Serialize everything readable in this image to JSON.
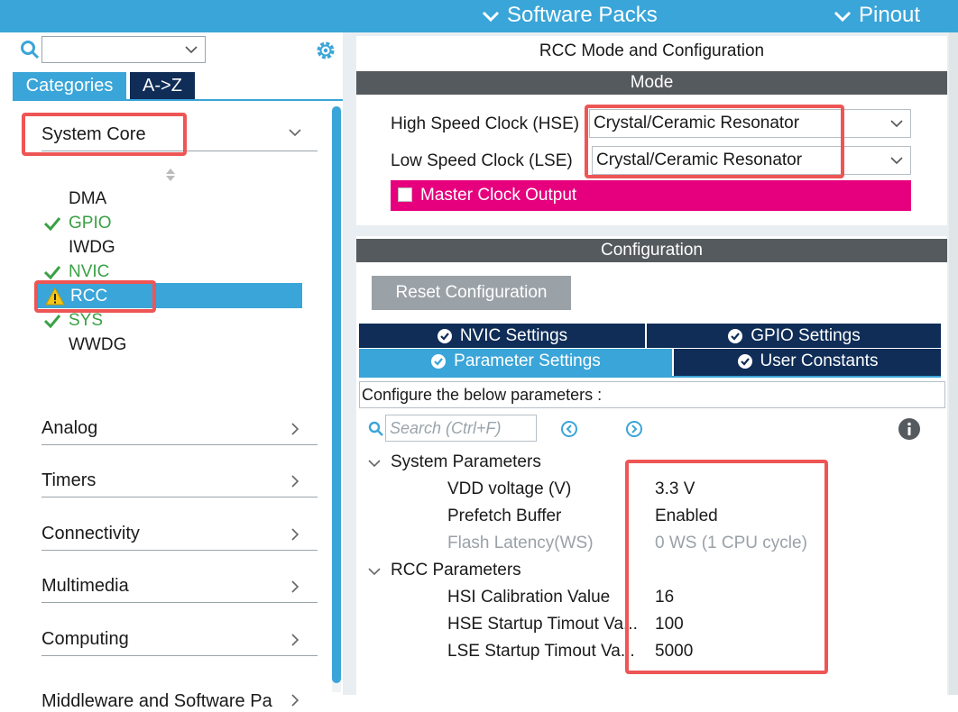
{
  "topbar": {
    "software_packs": "Software Packs",
    "pinout": "Pinout",
    "color": "#3aa5d8"
  },
  "left": {
    "search": {
      "value": "",
      "placeholder": ""
    },
    "tabs": [
      {
        "label": "Categories",
        "active": true
      },
      {
        "label": "A->Z",
        "active": false
      }
    ],
    "system_core": {
      "label": "System Core",
      "items": [
        {
          "label": "DMA",
          "state": "none"
        },
        {
          "label": "GPIO",
          "state": "ok"
        },
        {
          "label": "IWDG",
          "state": "none"
        },
        {
          "label": "NVIC",
          "state": "ok"
        },
        {
          "label": "RCC",
          "state": "warning",
          "selected": true
        },
        {
          "label": "SYS",
          "state": "ok"
        },
        {
          "label": "WWDG",
          "state": "none"
        }
      ]
    },
    "categories": [
      {
        "label": "Analog"
      },
      {
        "label": "Timers"
      },
      {
        "label": "Connectivity"
      },
      {
        "label": "Multimedia"
      },
      {
        "label": "Computing"
      },
      {
        "label": "Middleware and Software Pa"
      }
    ]
  },
  "rcc": {
    "title": "RCC Mode and Configuration",
    "mode_header": "Mode",
    "hse_label": "High Speed Clock (HSE)",
    "hse_value": "Crystal/Ceramic Resonator",
    "lse_label": "Low Speed Clock (LSE)",
    "lse_value": "Crystal/Ceramic Resonator",
    "mco_label": "Master Clock Output",
    "mco_color": "#e6007e",
    "config_header": "Configuration",
    "reset_button": "Reset Configuration",
    "tabs": {
      "nvic": "NVIC Settings",
      "gpio": "GPIO Settings",
      "parameter": "Parameter Settings",
      "user_constants": "User Constants"
    },
    "describe": "Configure the below parameters :",
    "search_placeholder": "Search (Ctrl+F)",
    "groups": [
      {
        "label": "System Parameters",
        "params": [
          {
            "name": "VDD voltage (V)",
            "value": "3.3 V",
            "disabled": false
          },
          {
            "name": "Prefetch Buffer",
            "value": "Enabled",
            "disabled": false
          },
          {
            "name": "Flash Latency(WS)",
            "value": "0 WS (1 CPU cycle)",
            "disabled": true
          }
        ]
      },
      {
        "label": "RCC Parameters",
        "params": [
          {
            "name": "HSI Calibration Value",
            "value": "16",
            "disabled": false
          },
          {
            "name": "HSE Startup Timout Va...",
            "value": "100",
            "disabled": false
          },
          {
            "name": "LSE Startup Timout Va...",
            "value": "5000",
            "disabled": false
          }
        ]
      }
    ]
  },
  "highlight_color": "#ee5555"
}
